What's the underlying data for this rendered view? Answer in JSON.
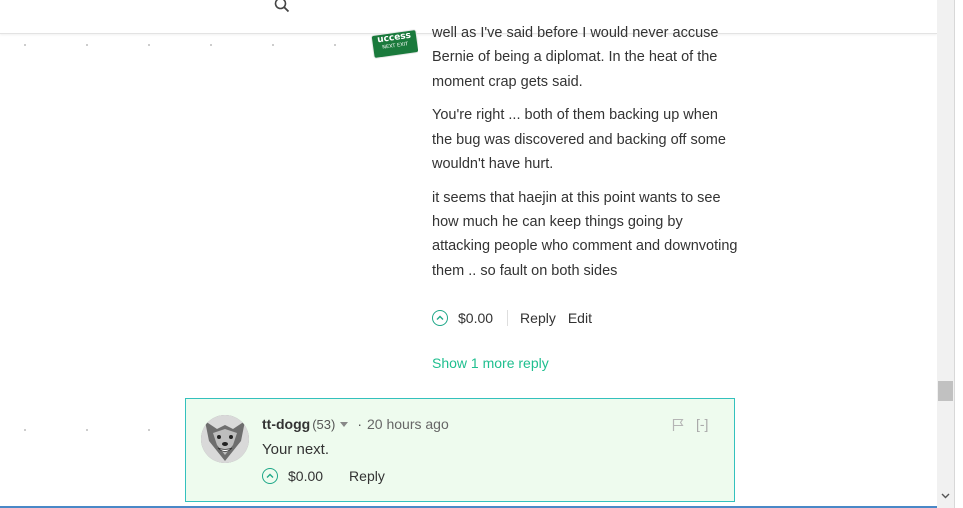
{
  "parent_comment": {
    "paragraphs": [
      "well as I've said before I would never accuse Bernie of being a diplomat. In the heat of the moment crap gets said.",
      "You're right ... both of them backing up when the bug was discovered and backing off some wouldn't have hurt.",
      "it seems that haejin at this point wants to see how much he can keep things going by attacking people who comment and downvoting them .. so fault on both sides"
    ],
    "avatar_text_big": "uccess",
    "avatar_text_small": "NEXT EXIT",
    "payout": "$0.00",
    "reply_label": "Reply",
    "edit_label": "Edit"
  },
  "show_more_label": "Show 1 more reply",
  "reply_comment": {
    "author": "tt-dogg",
    "reputation": "(53)",
    "dot": "·",
    "time": "20 hours ago",
    "collapse_label": "[-]",
    "text": "Your next.",
    "payout": "$0.00",
    "reply_label": "Reply"
  },
  "colors": {
    "accent_green": "#1fbf8f",
    "reply_highlight_bg": "#eefbee",
    "reply_highlight_border": "#33c1bd"
  },
  "icons": [
    "search-icon",
    "upvote-icon",
    "flag-icon",
    "chevron-down-icon"
  ]
}
